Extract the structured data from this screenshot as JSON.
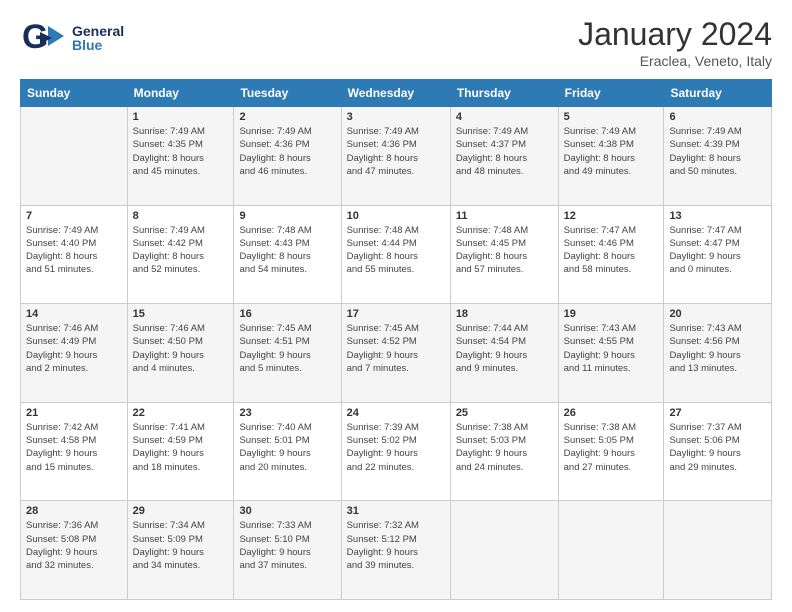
{
  "logo": {
    "general": "General",
    "blue": "Blue"
  },
  "title": "January 2024",
  "subtitle": "Eraclea, Veneto, Italy",
  "days": [
    "Sunday",
    "Monday",
    "Tuesday",
    "Wednesday",
    "Thursday",
    "Friday",
    "Saturday"
  ],
  "weeks": [
    [
      {
        "num": "",
        "sunrise": "",
        "sunset": "",
        "daylight": ""
      },
      {
        "num": "1",
        "sunrise": "Sunrise: 7:49 AM",
        "sunset": "Sunset: 4:35 PM",
        "daylight": "Daylight: 8 hours and 45 minutes."
      },
      {
        "num": "2",
        "sunrise": "Sunrise: 7:49 AM",
        "sunset": "Sunset: 4:36 PM",
        "daylight": "Daylight: 8 hours and 46 minutes."
      },
      {
        "num": "3",
        "sunrise": "Sunrise: 7:49 AM",
        "sunset": "Sunset: 4:36 PM",
        "daylight": "Daylight: 8 hours and 47 minutes."
      },
      {
        "num": "4",
        "sunrise": "Sunrise: 7:49 AM",
        "sunset": "Sunset: 4:37 PM",
        "daylight": "Daylight: 8 hours and 48 minutes."
      },
      {
        "num": "5",
        "sunrise": "Sunrise: 7:49 AM",
        "sunset": "Sunset: 4:38 PM",
        "daylight": "Daylight: 8 hours and 49 minutes."
      },
      {
        "num": "6",
        "sunrise": "Sunrise: 7:49 AM",
        "sunset": "Sunset: 4:39 PM",
        "daylight": "Daylight: 8 hours and 50 minutes."
      }
    ],
    [
      {
        "num": "7",
        "sunrise": "Sunrise: 7:49 AM",
        "sunset": "Sunset: 4:40 PM",
        "daylight": "Daylight: 8 hours and 51 minutes."
      },
      {
        "num": "8",
        "sunrise": "Sunrise: 7:49 AM",
        "sunset": "Sunset: 4:42 PM",
        "daylight": "Daylight: 8 hours and 52 minutes."
      },
      {
        "num": "9",
        "sunrise": "Sunrise: 7:48 AM",
        "sunset": "Sunset: 4:43 PM",
        "daylight": "Daylight: 8 hours and 54 minutes."
      },
      {
        "num": "10",
        "sunrise": "Sunrise: 7:48 AM",
        "sunset": "Sunset: 4:44 PM",
        "daylight": "Daylight: 8 hours and 55 minutes."
      },
      {
        "num": "11",
        "sunrise": "Sunrise: 7:48 AM",
        "sunset": "Sunset: 4:45 PM",
        "daylight": "Daylight: 8 hours and 57 minutes."
      },
      {
        "num": "12",
        "sunrise": "Sunrise: 7:47 AM",
        "sunset": "Sunset: 4:46 PM",
        "daylight": "Daylight: 8 hours and 58 minutes."
      },
      {
        "num": "13",
        "sunrise": "Sunrise: 7:47 AM",
        "sunset": "Sunset: 4:47 PM",
        "daylight": "Daylight: 9 hours and 0 minutes."
      }
    ],
    [
      {
        "num": "14",
        "sunrise": "Sunrise: 7:46 AM",
        "sunset": "Sunset: 4:49 PM",
        "daylight": "Daylight: 9 hours and 2 minutes."
      },
      {
        "num": "15",
        "sunrise": "Sunrise: 7:46 AM",
        "sunset": "Sunset: 4:50 PM",
        "daylight": "Daylight: 9 hours and 4 minutes."
      },
      {
        "num": "16",
        "sunrise": "Sunrise: 7:45 AM",
        "sunset": "Sunset: 4:51 PM",
        "daylight": "Daylight: 9 hours and 5 minutes."
      },
      {
        "num": "17",
        "sunrise": "Sunrise: 7:45 AM",
        "sunset": "Sunset: 4:52 PM",
        "daylight": "Daylight: 9 hours and 7 minutes."
      },
      {
        "num": "18",
        "sunrise": "Sunrise: 7:44 AM",
        "sunset": "Sunset: 4:54 PM",
        "daylight": "Daylight: 9 hours and 9 minutes."
      },
      {
        "num": "19",
        "sunrise": "Sunrise: 7:43 AM",
        "sunset": "Sunset: 4:55 PM",
        "daylight": "Daylight: 9 hours and 11 minutes."
      },
      {
        "num": "20",
        "sunrise": "Sunrise: 7:43 AM",
        "sunset": "Sunset: 4:56 PM",
        "daylight": "Daylight: 9 hours and 13 minutes."
      }
    ],
    [
      {
        "num": "21",
        "sunrise": "Sunrise: 7:42 AM",
        "sunset": "Sunset: 4:58 PM",
        "daylight": "Daylight: 9 hours and 15 minutes."
      },
      {
        "num": "22",
        "sunrise": "Sunrise: 7:41 AM",
        "sunset": "Sunset: 4:59 PM",
        "daylight": "Daylight: 9 hours and 18 minutes."
      },
      {
        "num": "23",
        "sunrise": "Sunrise: 7:40 AM",
        "sunset": "Sunset: 5:01 PM",
        "daylight": "Daylight: 9 hours and 20 minutes."
      },
      {
        "num": "24",
        "sunrise": "Sunrise: 7:39 AM",
        "sunset": "Sunset: 5:02 PM",
        "daylight": "Daylight: 9 hours and 22 minutes."
      },
      {
        "num": "25",
        "sunrise": "Sunrise: 7:38 AM",
        "sunset": "Sunset: 5:03 PM",
        "daylight": "Daylight: 9 hours and 24 minutes."
      },
      {
        "num": "26",
        "sunrise": "Sunrise: 7:38 AM",
        "sunset": "Sunset: 5:05 PM",
        "daylight": "Daylight: 9 hours and 27 minutes."
      },
      {
        "num": "27",
        "sunrise": "Sunrise: 7:37 AM",
        "sunset": "Sunset: 5:06 PM",
        "daylight": "Daylight: 9 hours and 29 minutes."
      }
    ],
    [
      {
        "num": "28",
        "sunrise": "Sunrise: 7:36 AM",
        "sunset": "Sunset: 5:08 PM",
        "daylight": "Daylight: 9 hours and 32 minutes."
      },
      {
        "num": "29",
        "sunrise": "Sunrise: 7:34 AM",
        "sunset": "Sunset: 5:09 PM",
        "daylight": "Daylight: 9 hours and 34 minutes."
      },
      {
        "num": "30",
        "sunrise": "Sunrise: 7:33 AM",
        "sunset": "Sunset: 5:10 PM",
        "daylight": "Daylight: 9 hours and 37 minutes."
      },
      {
        "num": "31",
        "sunrise": "Sunrise: 7:32 AM",
        "sunset": "Sunset: 5:12 PM",
        "daylight": "Daylight: 9 hours and 39 minutes."
      },
      {
        "num": "",
        "sunrise": "",
        "sunset": "",
        "daylight": ""
      },
      {
        "num": "",
        "sunrise": "",
        "sunset": "",
        "daylight": ""
      },
      {
        "num": "",
        "sunrise": "",
        "sunset": "",
        "daylight": ""
      }
    ]
  ]
}
